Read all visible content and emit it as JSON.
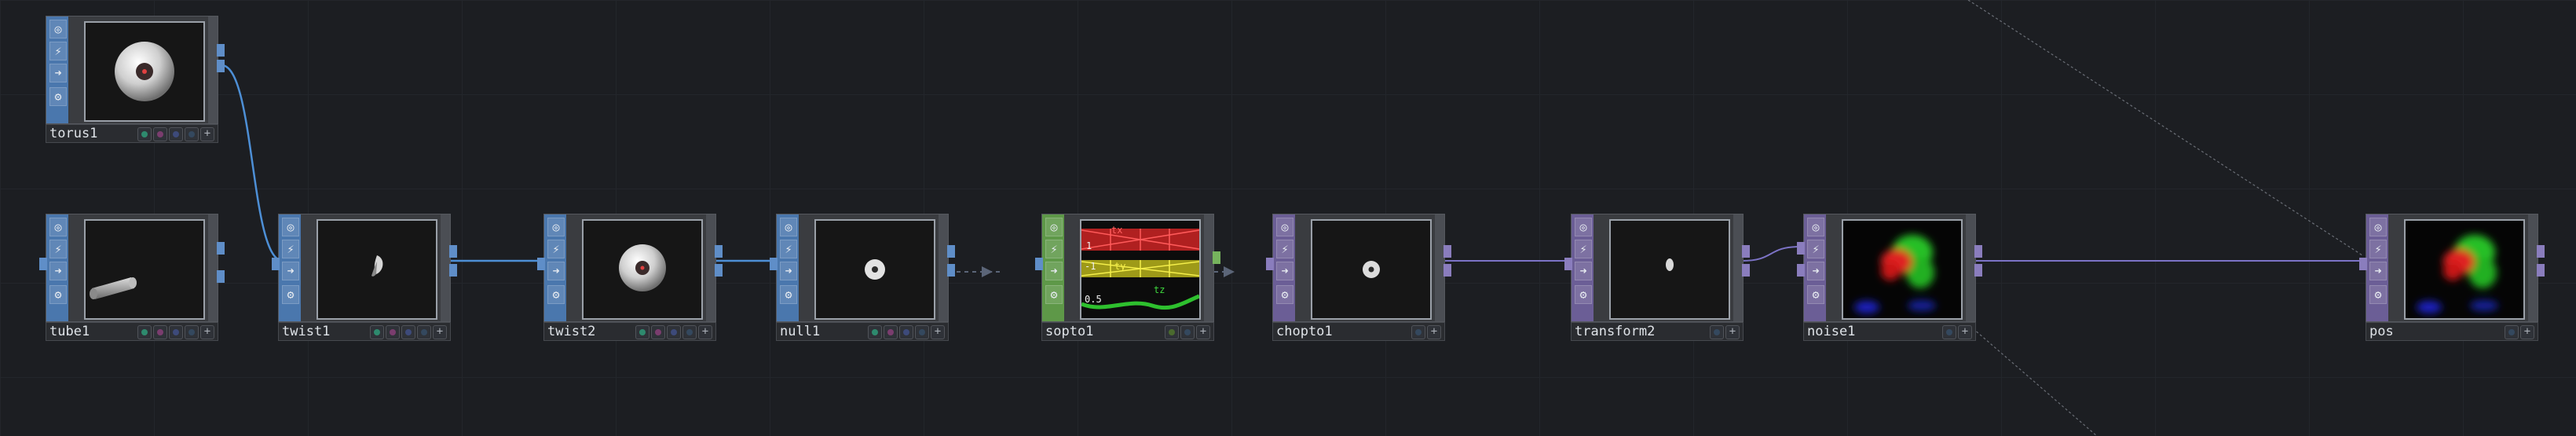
{
  "network": {
    "nodes": [
      {
        "id": "torus1",
        "name": "torus1",
        "family": "SOP",
        "preview": "torus-front",
        "flags": [
          "display",
          "render",
          "bypass",
          "lock",
          "add"
        ]
      },
      {
        "id": "tube1",
        "name": "tube1",
        "family": "SOP",
        "preview": "tube",
        "flags": [
          "display",
          "render",
          "bypass",
          "lock",
          "add"
        ]
      },
      {
        "id": "twist1",
        "name": "twist1",
        "family": "SOP",
        "preview": "twisted-sliver",
        "flags": [
          "display",
          "render",
          "bypass",
          "lock",
          "add"
        ]
      },
      {
        "id": "twist2",
        "name": "twist2",
        "family": "SOP",
        "preview": "torus-front",
        "flags": [
          "display",
          "render",
          "bypass",
          "lock",
          "add"
        ]
      },
      {
        "id": "null1",
        "name": "null1",
        "family": "SOP",
        "preview": "small-torus",
        "flags": [
          "display",
          "render",
          "bypass",
          "lock",
          "add"
        ]
      },
      {
        "id": "sopto1",
        "name": "sopto1",
        "family": "CHOP",
        "preview": "channel-graph",
        "flags": [
          "display",
          "lock",
          "add"
        ]
      },
      {
        "id": "chopto1",
        "name": "chopto1",
        "family": "SOP",
        "preview": "small-torus-2",
        "flags": [
          "lock",
          "add"
        ]
      },
      {
        "id": "transform2",
        "name": "transform2",
        "family": "SOP",
        "preview": "tiny-blob",
        "flags": [
          "lock",
          "add"
        ]
      },
      {
        "id": "noise1",
        "name": "noise1",
        "family": "SOP",
        "preview": "rgb-noise",
        "flags": [
          "lock",
          "add"
        ]
      },
      {
        "id": "pos",
        "name": "pos",
        "family": "SOP",
        "preview": "rgb-noise",
        "flags": [
          "lock",
          "add"
        ]
      }
    ],
    "sopto1_graph": {
      "labels": [
        "tx",
        "ty",
        "tz",
        "1",
        "-1",
        "0.5"
      ],
      "colors": {
        "tx": "#d83030",
        "ty": "#d8d030",
        "tz": "#30c030"
      }
    },
    "colors": {
      "sop_strip": "#4a77ad",
      "chop_strip": "#6b5e96",
      "convert_strip": "#5e9848",
      "wire_sop": "#4d8fd6",
      "wire_chop": "#7c73c6",
      "wire_convert": "#5b6578",
      "background": "#1c1e22"
    }
  }
}
